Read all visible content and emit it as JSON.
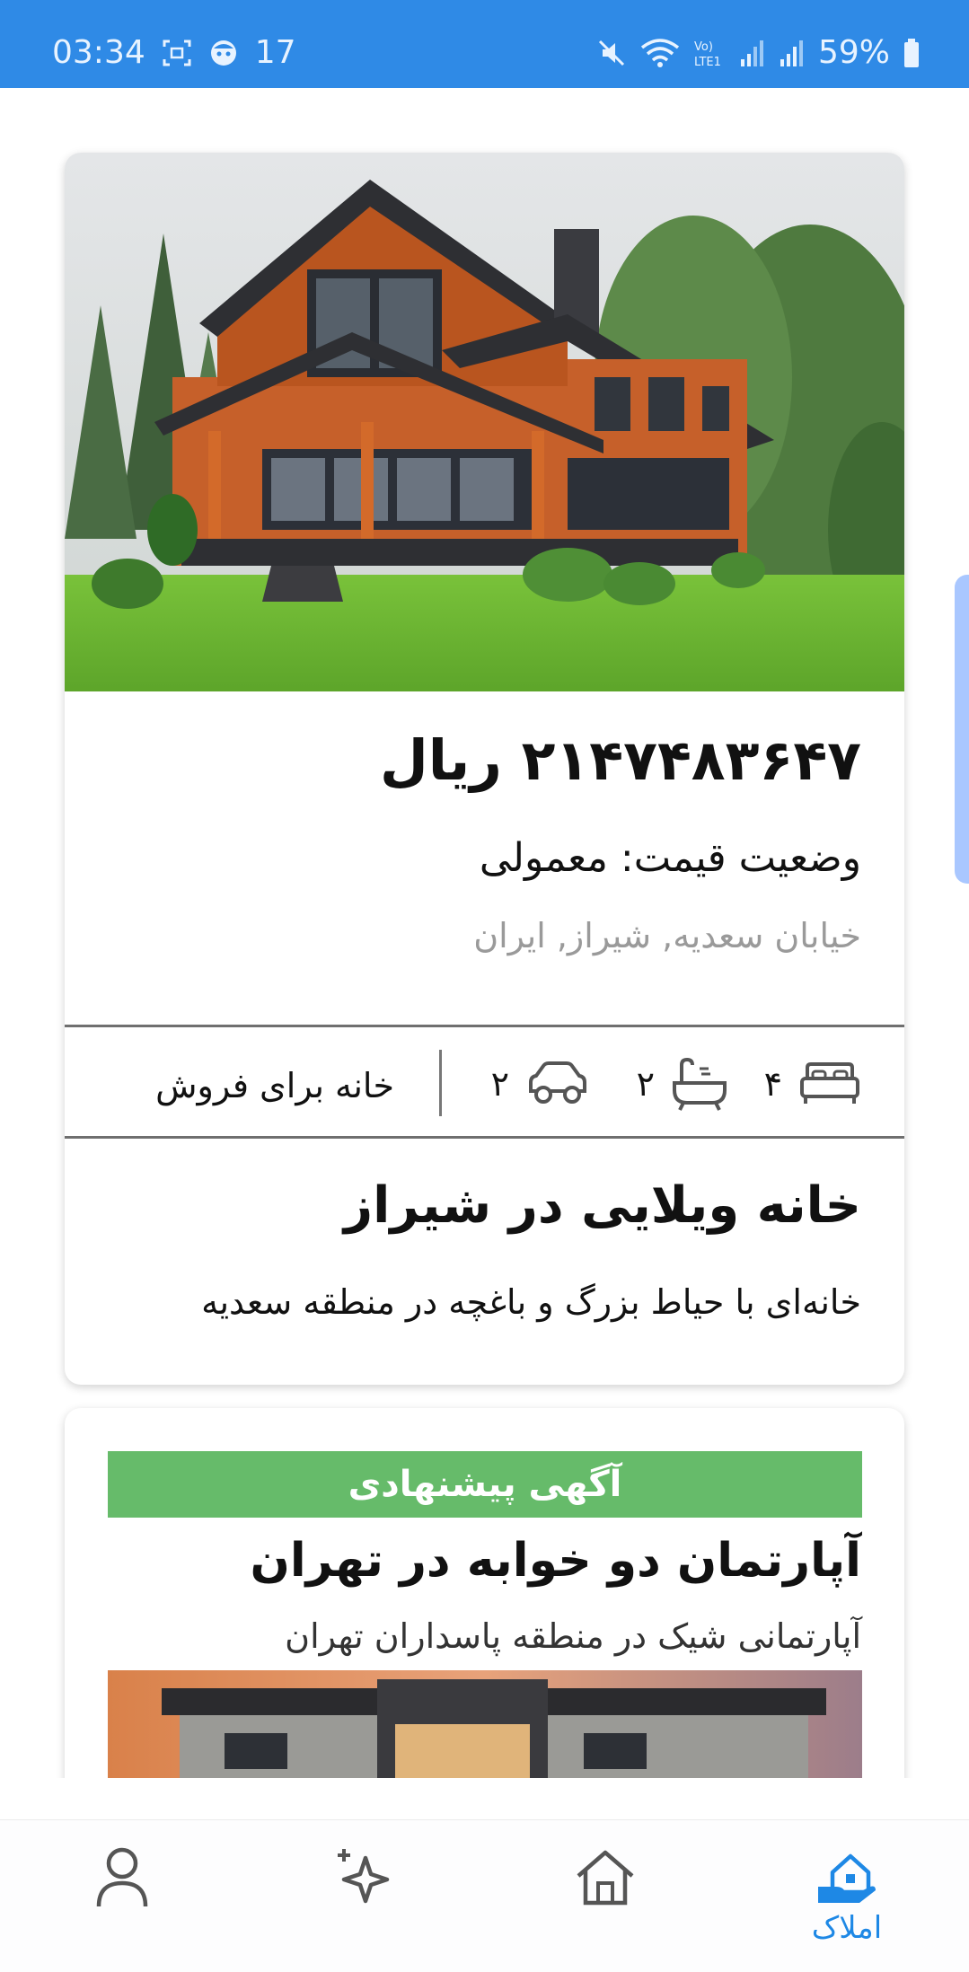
{
  "status_bar": {
    "time": "03:34",
    "notification_count": "17",
    "battery": "59%",
    "network_label": "Vo) LTE1",
    "color": "#2f8ae6"
  },
  "listing_1": {
    "price": "۲۱۴۷۴۸۳۶۴۷ ریال",
    "price_status": "وضعیت قیمت: معمولی",
    "address": "خیابان سعدیه, شیراز, ایران",
    "bedrooms": "۴",
    "bathrooms": "۲",
    "parking": "۲",
    "property_type": "خانه برای فروش",
    "title": "خانه ویلایی در شیراز",
    "description": "خانه‌ای با حیاط بزرگ و باغچه در منطقه سعدیه"
  },
  "listing_2": {
    "badge": "آگهی پیشنهادی",
    "title": "آپارتمان دو خوابه در تهران",
    "description": "آپارتمانی شیک در منطقه پاسداران تهران"
  },
  "bottom_nav": {
    "items": [
      {
        "icon": "profile-icon",
        "label": ""
      },
      {
        "icon": "sparkle-icon",
        "label": ""
      },
      {
        "icon": "home-icon",
        "label": ""
      },
      {
        "icon": "properties-icon",
        "label": "املاک",
        "active": true
      }
    ],
    "accent": "#1e88e5"
  },
  "colors": {
    "sponsored_badge": "#66bb6a",
    "muted_text": "#9a9a9a"
  }
}
